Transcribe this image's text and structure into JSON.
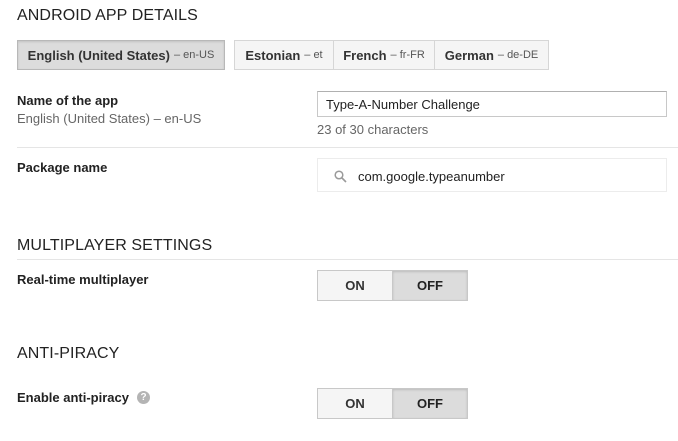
{
  "sections": {
    "android": "ANDROID APP DETAILS",
    "multiplayer": "MULTIPLAYER SETTINGS",
    "antipiracy": "ANTI-PIRACY"
  },
  "languages": [
    {
      "name": "English (United States)",
      "code": "– en-US",
      "selected": true
    },
    {
      "name": "Estonian",
      "code": "– et",
      "selected": false
    },
    {
      "name": "French",
      "code": "– fr-FR",
      "selected": false
    },
    {
      "name": "German",
      "code": "– de-DE",
      "selected": false
    }
  ],
  "app_name": {
    "label": "Name of the app",
    "locale": "English (United States) – en-US",
    "value": "Type-A-Number Challenge",
    "char_count": "23 of 30 characters"
  },
  "package": {
    "label": "Package name",
    "value": "com.google.typeanumber",
    "icon": "search-icon"
  },
  "realtime": {
    "label": "Real-time multiplayer",
    "on_label": "ON",
    "off_label": "OFF",
    "value": "OFF"
  },
  "antipiracy": {
    "label": "Enable anti-piracy",
    "help_icon": "?",
    "on_label": "ON",
    "off_label": "OFF",
    "value": "OFF"
  }
}
